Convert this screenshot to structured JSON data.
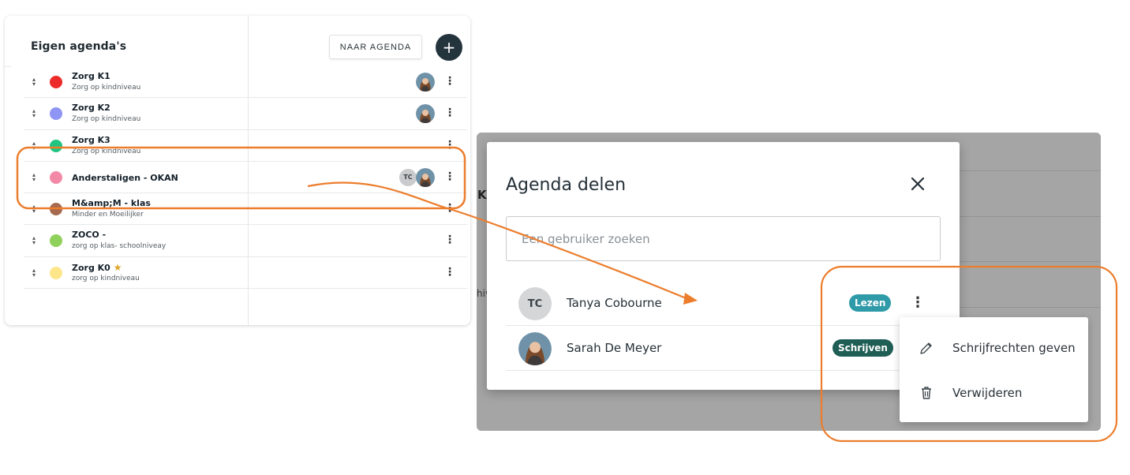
{
  "left_panel": {
    "title": "Eigen agenda's",
    "naar_agenda_label": "NAAR AGENDA",
    "add_symbol": "+",
    "agendas": [
      {
        "name": "Zorg K1",
        "sub": "Zorg op kindniveau",
        "color": "#ee2b2b",
        "shared": [
          "avatar"
        ]
      },
      {
        "name": "Zorg K2",
        "sub": "Zorg op kindniveau",
        "color": "#8e95f4",
        "shared": [
          "avatar"
        ]
      },
      {
        "name": "Zorg K3",
        "sub": "Zorg op kindniveau",
        "color": "#1fc580",
        "shared": []
      },
      {
        "name": "Anderstaligen - OKAN",
        "sub": "",
        "color": "#f28aa7",
        "shared": [
          "TC",
          "avatar"
        ]
      },
      {
        "name": "M&amp;M - klas",
        "sub": "Minder en Moeilijker",
        "color": "#a66a4f",
        "shared": []
      },
      {
        "name": "ZOCO -",
        "sub": "zorg op klas- schoolniveay",
        "color": "#8fd15a",
        "shared": []
      },
      {
        "name": "Zorg K0",
        "sub": "zorg op kindniveau",
        "color": "#fde68a",
        "shared": [],
        "starred": true
      }
    ],
    "tc_initials": "TC"
  },
  "background": {
    "partial_heading": "K",
    "partial_text": "hiv"
  },
  "modal": {
    "title": "Agenda delen",
    "search_placeholder": "Een gebruiker zoeken",
    "users": [
      {
        "initials": "TC",
        "name": "Tanya Cobourne",
        "role": "Lezen",
        "role_color": "#2f9aa8"
      },
      {
        "name": "Sarah De Meyer",
        "role": "Schrijven",
        "role_color": "#1f5e55"
      }
    ]
  },
  "context_menu": {
    "items": [
      {
        "label": "Schrijfrechten geven",
        "icon": "pencil-icon"
      },
      {
        "label": "Verwijderen",
        "icon": "trash-icon"
      }
    ]
  },
  "colors": {
    "annotation": "#ec7d2c",
    "dark_button": "#24343d"
  }
}
